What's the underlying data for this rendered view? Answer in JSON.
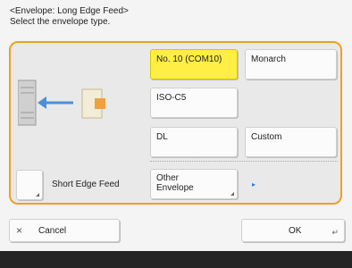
{
  "header": {
    "title": "<Envelope: Long Edge Feed>",
    "subtitle": "Select the envelope type."
  },
  "options": {
    "no10": "No. 10 (COM10)",
    "monarch": "Monarch",
    "iso_c5": "ISO-C5",
    "dl": "DL",
    "custom": "Custom",
    "other_line1": "Other",
    "other_line2": "Envelope",
    "short_edge": "Short Edge Feed"
  },
  "footer": {
    "cancel": "Cancel",
    "ok": "OK"
  },
  "colors": {
    "selected": "#ffee44",
    "panel_border": "#f0a020",
    "arrow": "#4a90d9",
    "envelope": "#f0a040"
  },
  "icons": {
    "cancel": "close-icon",
    "ok": "enter-icon",
    "more": "arrow-right-icon"
  }
}
